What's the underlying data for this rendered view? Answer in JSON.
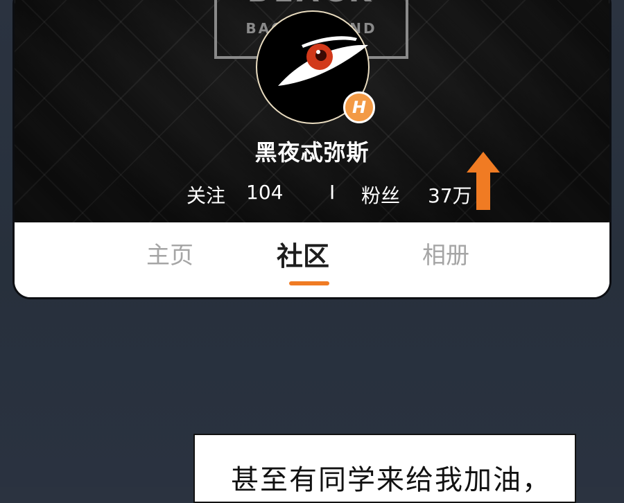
{
  "profile": {
    "banner_text_top": "BLACK",
    "banner_text_bottom": "BACKGROUND",
    "badge_letter": "H",
    "username": "黑夜忒弥斯",
    "following_label": "关注",
    "following_count": "104",
    "separator": "I",
    "followers_label": "粉丝",
    "followers_count": "37万"
  },
  "tabs": [
    {
      "label": "主页",
      "active": false
    },
    {
      "label": "社区",
      "active": true
    },
    {
      "label": "相册",
      "active": false
    }
  ],
  "caption": {
    "text": "甚至有同学来给我加油，"
  },
  "colors": {
    "accent": "#f07b23",
    "badge": "#f39a45",
    "eye_red": "#d2391a",
    "page_bg": "#27303c"
  },
  "icons": {
    "avatar": "eye-icon",
    "arrow": "arrow-up-icon"
  }
}
